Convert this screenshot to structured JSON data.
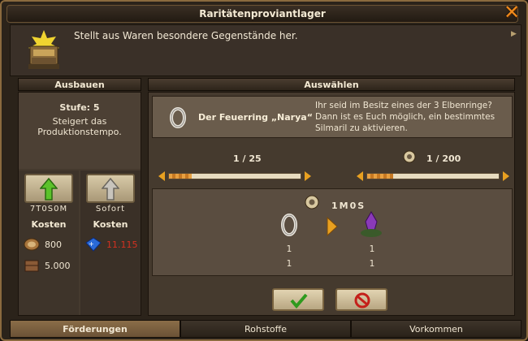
{
  "window": {
    "title": "Raritätenproviantlager"
  },
  "description": {
    "text": "Stellt aus Waren besondere Gegenstände her."
  },
  "left_panel": {
    "header": "Ausbauen",
    "level": "Stufe: 5",
    "info": "Steigert das Produktionstempo.",
    "upgrade": {
      "caption": "7T0S0M",
      "kosten_label": "Kosten",
      "costs": [
        "800",
        "5.000"
      ]
    },
    "instant": {
      "caption": "Sofort",
      "kosten_label": "Kosten",
      "cost": "11.115"
    }
  },
  "right_panel": {
    "header": "Auswählen",
    "ring_name": "Der Feuerring „Narya“",
    "ring_description": "Ihr seid im Besitz eines der 3 Elbenringe? Dann ist es Euch möglich, ein bestimmtes Silmaril zu aktivieren.",
    "counter_left": "1 / 25",
    "counter_right": "1 / 200",
    "slider_left_fill": 0.17,
    "slider_right_fill": 0.2,
    "time": "1M0S",
    "input_counts": [
      "1",
      "1"
    ],
    "output_counts": [
      "1",
      "1"
    ]
  },
  "tabs": [
    "Förderungen",
    "Rohstoffe",
    "Vorkommen"
  ],
  "active_tab": 0,
  "colors": {
    "accent_orange": "#e8a020",
    "diamond_cost": "#d43020",
    "confirm_green": "#2e9a1e",
    "cancel_red": "#c4201a"
  }
}
